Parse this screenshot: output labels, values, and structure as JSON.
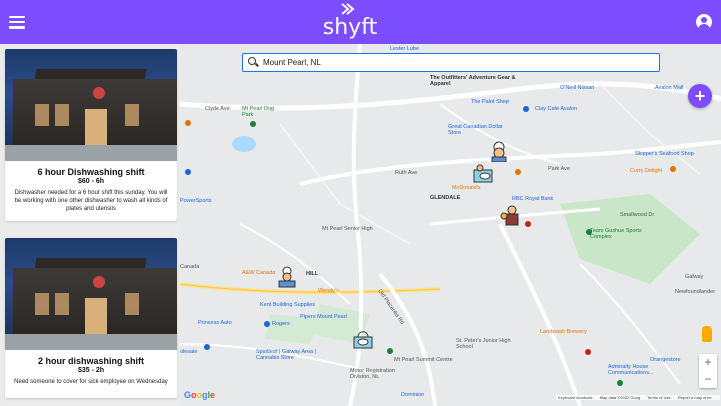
{
  "app": {
    "logo_text": "shyft",
    "brand_color": "#7c4dff"
  },
  "header": {
    "menu_icon": "hamburger-menu-icon",
    "account_icon": "account-circle-icon"
  },
  "shifts": [
    {
      "title": "6 hour Dishwashing shift",
      "pay": "$60 - 6h",
      "description": "Dishwasher needed for a 6 hour shift this sunday. You will be working with one other dishwasher to wash all kinds of plates and utensils"
    },
    {
      "title": "2 hour dishwashing shift",
      "pay": "$35 - 2h",
      "description": "Need someone to cover for sick employee on Wednesday"
    }
  ],
  "search": {
    "value": "Mount Pearl, NL"
  },
  "fab": {
    "label": "+"
  },
  "map": {
    "labels": {
      "lester_lube": "Lester Lube",
      "outfitters": "The Outfitters' Adventure Gear & Apparel",
      "oneill_nissan": "O'Neill Nissan",
      "avalon_mall": "Avalon Mall",
      "paint_shop": "The Paint Shop",
      "clay_cafe": "Clay Cafe Avalon",
      "clyde_ave": "Clyde Ave",
      "mt_pearl_dog_park": "Mt Pearl Dog Park",
      "great_canadian": "Great Canadian Dollar Store",
      "ruth_ave": "Ruth Ave",
      "park_ave": "Park Ave",
      "skippers": "Skipper's Seafood Shop",
      "curry_delight": "Curry Delight",
      "mcdonalds": "McDonald's",
      "rbc": "RBC Royal Bank",
      "glendale": "GLENDALE",
      "power_sports": "PowerSports",
      "senior_high": "Mt Pearl Senior High",
      "smallwood": "Smallwood Dr",
      "team_gushue": "Team Gushue Sports Complex",
      "aw_canada": "A&W Canada",
      "hill": "HILL",
      "wendys": "Wendy's",
      "kent": "Kent Building Supplies",
      "pipers": "Pipers Mount Pearl",
      "princess_auto": "Princess Auto",
      "rogers": "Rogers",
      "spiritleaf": "Spiritleaf | Galway Area | Cannabis Store",
      "mt_pearl_summit": "Mt Pearl Summit Centre",
      "motor_reg": "Motor Registration Division, NL",
      "dominion": "Dominion",
      "landwash": "Landwash Brewery",
      "stpeters": "St. Peter's Junior High School",
      "orangestore": "Orangestore",
      "admiralty": "Admiralty House Communications...",
      "galway": "Galway",
      "newfoundlander": "Newfoundlander",
      "canada": "Canada",
      "wholesale": "olesale",
      "old_placentia": "Old Placentia Rd"
    },
    "google_logo": [
      "G",
      "o",
      "o",
      "g",
      "l",
      "e"
    ],
    "zoom_in": "+",
    "zoom_out": "−",
    "footer": [
      "Keyboard shortcuts",
      "Map data ©2022 Goog",
      "Terms of Use",
      "Report a map error"
    ]
  }
}
